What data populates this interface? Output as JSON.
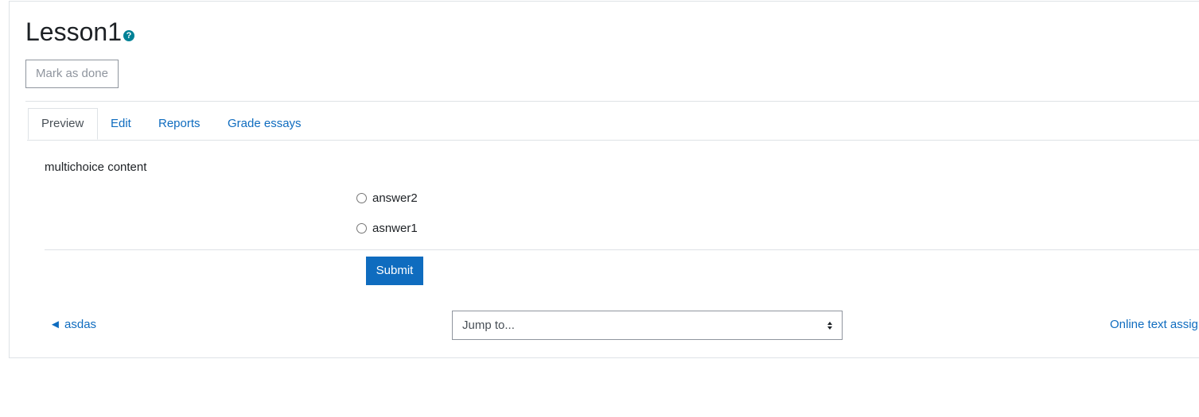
{
  "page": {
    "title": "Lesson1",
    "help_icon": "question-circle-icon",
    "mark_done_label": "Mark as done"
  },
  "tabs": [
    {
      "label": "Preview",
      "active": true
    },
    {
      "label": "Edit",
      "active": false
    },
    {
      "label": "Reports",
      "active": false
    },
    {
      "label": "Grade essays",
      "active": false
    }
  ],
  "question": {
    "text": "multichoice content",
    "options": [
      "answer2",
      "asnwer1"
    ],
    "submit_label": "Submit"
  },
  "navigation": {
    "prev_link": "◄ asdas",
    "jump_select_value": "Jump to...",
    "next_link": "Online text assig"
  },
  "colors": {
    "link": "#0f6cbf",
    "primary_button": "#0f6cbf",
    "help_icon": "#008196"
  }
}
